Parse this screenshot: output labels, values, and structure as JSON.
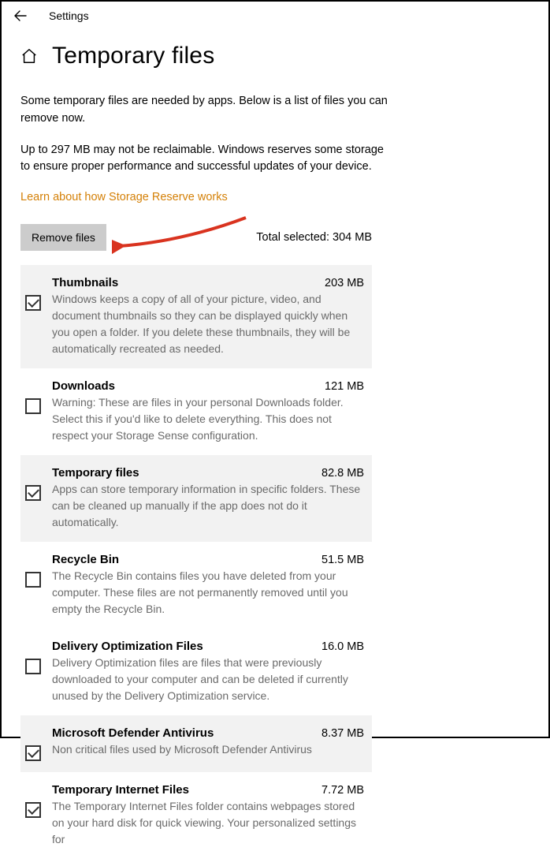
{
  "topbar": {
    "title": "Settings"
  },
  "header": {
    "title": "Temporary files"
  },
  "intro": {
    "p1": "Some temporary files are needed by apps. Below is a list of files you can remove now.",
    "p2": "Up to 297 MB may not be reclaimable. Windows reserves some storage to ensure proper performance and successful updates of your device.",
    "link": "Learn about how Storage Reserve works"
  },
  "action": {
    "remove_label": "Remove files",
    "total_label": "Total selected: 304 MB"
  },
  "items": [
    {
      "title": "Thumbnails",
      "size": "203 MB",
      "desc": "Windows keeps a copy of all of your picture, video, and document thumbnails so they can be displayed quickly when you open a folder. If you delete these thumbnails, they will be automatically recreated as needed.",
      "checked": true,
      "shaded": true
    },
    {
      "title": "Downloads",
      "size": "121 MB",
      "desc": "Warning: These are files in your personal Downloads folder. Select this if you'd like to delete everything. This does not respect your Storage Sense configuration.",
      "checked": false,
      "shaded": false
    },
    {
      "title": "Temporary files",
      "size": "82.8 MB",
      "desc": "Apps can store temporary information in specific folders. These can be cleaned up manually if the app does not do it automatically.",
      "checked": true,
      "shaded": true
    },
    {
      "title": "Recycle Bin",
      "size": "51.5 MB",
      "desc": "The Recycle Bin contains files you have deleted from your computer. These files are not permanently removed until you empty the Recycle Bin.",
      "checked": false,
      "shaded": false
    },
    {
      "title": "Delivery Optimization Files",
      "size": "16.0 MB",
      "desc": "Delivery Optimization files are files that were previously downloaded to your computer and can be deleted if currently unused by the Delivery Optimization service.",
      "checked": false,
      "shaded": false
    },
    {
      "title": "Microsoft Defender Antivirus",
      "size": "8.37 MB",
      "desc": "Non critical files used by Microsoft Defender Antivirus",
      "checked": true,
      "shaded": true
    },
    {
      "title": "Temporary Internet Files",
      "size": "7.72 MB",
      "desc": "The Temporary Internet Files folder contains webpages stored on your hard disk for quick viewing. Your personalized settings for",
      "checked": true,
      "shaded": false
    }
  ]
}
